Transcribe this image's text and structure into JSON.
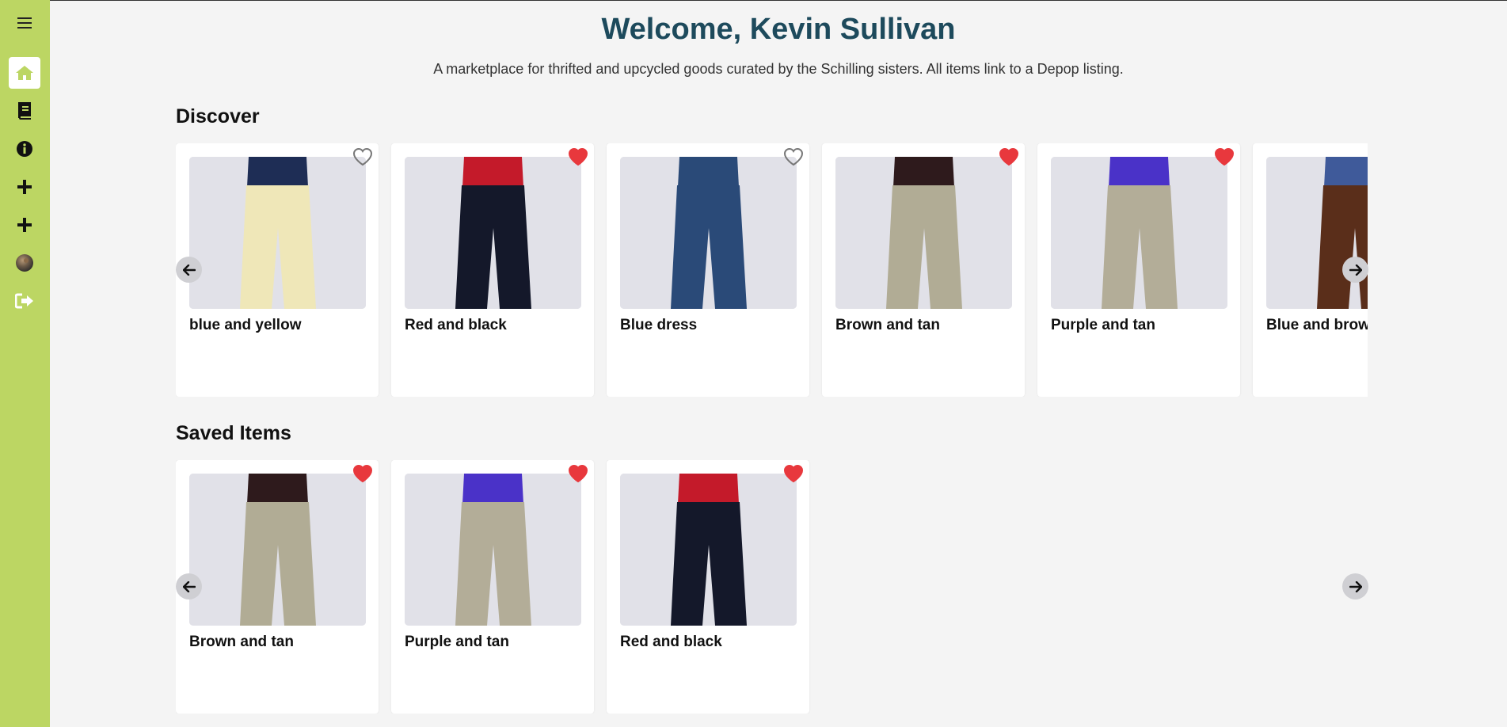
{
  "app": {
    "welcome": "Welcome, Kevin Sullivan",
    "tagline": "A marketplace for thrifted and upcycled goods curated by the Schilling sisters. All items link to a Depop listing."
  },
  "sidebar": {
    "items": [
      {
        "icon": "menu-icon"
      },
      {
        "icon": "home-icon",
        "active": true
      },
      {
        "icon": "book-icon"
      },
      {
        "icon": "info-icon"
      },
      {
        "icon": "plus-icon"
      },
      {
        "icon": "plus-icon"
      },
      {
        "icon": "avatar"
      },
      {
        "icon": "logout-icon"
      }
    ]
  },
  "discover": {
    "heading": "Discover",
    "items": [
      {
        "title": "blue and yellow",
        "liked": false,
        "top": "#1e2d55",
        "bottom": "#efe7b8"
      },
      {
        "title": "Red and black",
        "liked": true,
        "top": "#c41a2a",
        "bottom": "#14182a"
      },
      {
        "title": "Blue dress",
        "liked": false,
        "top": "#2a4a78",
        "bottom": "#2a4a78"
      },
      {
        "title": "Brown and tan",
        "liked": true,
        "top": "#2e1a1c",
        "bottom": "#b1ac95"
      },
      {
        "title": "Purple and tan",
        "liked": true,
        "top": "#4a32c8",
        "bottom": "#b3ad98"
      },
      {
        "title": "Blue and brown",
        "liked": true,
        "top": "#3f5a9a",
        "bottom": "#5a2e1a"
      }
    ]
  },
  "saved": {
    "heading": "Saved Items",
    "items": [
      {
        "title": "Brown and tan",
        "liked": true,
        "top": "#2e1a1c",
        "bottom": "#b1ac95"
      },
      {
        "title": "Purple and tan",
        "liked": true,
        "top": "#4a32c8",
        "bottom": "#b3ad98"
      },
      {
        "title": "Red and black",
        "liked": true,
        "top": "#c41a2a",
        "bottom": "#14182a"
      }
    ]
  },
  "colors": {
    "sidebar": "#bcd663",
    "title": "#1d4a5c",
    "heart_active": "#e8383d",
    "heart_inactive": "#777777"
  }
}
